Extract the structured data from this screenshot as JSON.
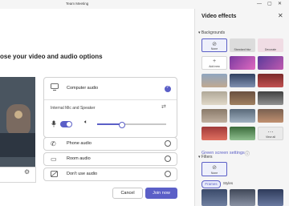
{
  "window": {
    "title": "Team Meeting",
    "min_glyph": "—",
    "max_glyph": "▢",
    "close_glyph": "✕"
  },
  "prejoin": {
    "heading": "ose your video and audio options",
    "video_settings_icon": "gear-icon",
    "audio_options": [
      {
        "label": "Computer audio",
        "icon": "speaker-monitor-icon",
        "selected": true
      },
      {
        "label": "Phone audio",
        "icon": "phone-icon",
        "selected": false
      },
      {
        "label": "Room audio",
        "icon": "room-audio-icon",
        "selected": false
      },
      {
        "label": "Don't use audio",
        "icon": "speaker-off-icon",
        "selected": false
      }
    ],
    "device_label": "Internal Mic and Speaker",
    "mic_on": true,
    "speaker_volume": 0.35,
    "cancel_label": "Cancel",
    "join_label": "Join now"
  },
  "effects": {
    "title": "Video effects",
    "backgrounds_label": "Backgrounds",
    "bg_items": [
      {
        "label": "None",
        "glyph": "⊘"
      },
      {
        "label": "Standard blur",
        "glyph": ""
      },
      {
        "label": "Decorate",
        "glyph": ""
      },
      {
        "label": "Add new",
        "glyph": "+"
      },
      {
        "label": "",
        "glyph": ""
      },
      {
        "label": "",
        "glyph": ""
      },
      {
        "label": "",
        "glyph": ""
      },
      {
        "label": "",
        "glyph": ""
      },
      {
        "label": "",
        "glyph": ""
      },
      {
        "label": "",
        "glyph": ""
      },
      {
        "label": "",
        "glyph": ""
      },
      {
        "label": "",
        "glyph": ""
      },
      {
        "label": "",
        "glyph": ""
      },
      {
        "label": "",
        "glyph": ""
      },
      {
        "label": "",
        "glyph": ""
      },
      {
        "label": "",
        "glyph": ""
      },
      {
        "label": "",
        "glyph": ""
      },
      {
        "label": "View all",
        "glyph": "⋯"
      }
    ],
    "green_screen_label": "Green screen settings",
    "filters_label": "Filters",
    "filter_none_label": "None",
    "filter_tabs": [
      "Frames",
      "Styles"
    ]
  },
  "colors": {
    "accent": "#5b5fc7"
  }
}
